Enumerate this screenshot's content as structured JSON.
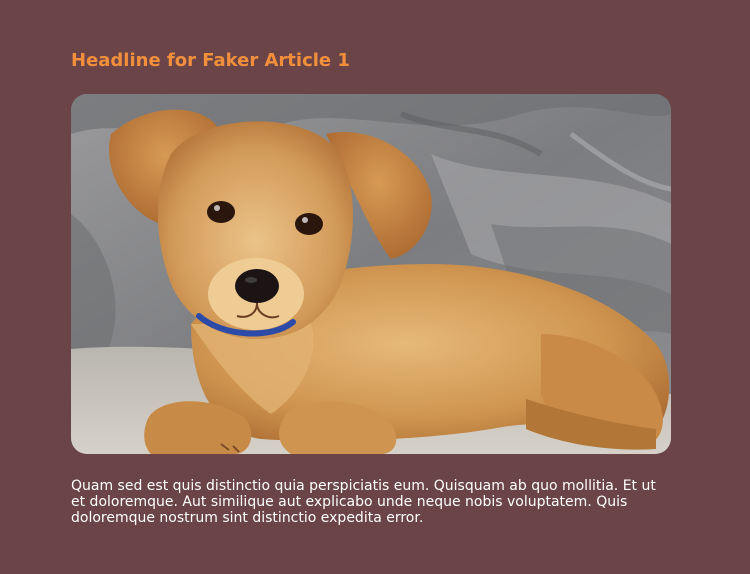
{
  "article": {
    "headline": "Headline for Faker Article 1",
    "image": {
      "subject": "puppy-photo"
    },
    "body": "Quam sed est quis distinctio quia perspiciatis eum. Quisquam ab quo mollitia. Et ut et doloremque. Aut similique aut explicabo unde neque nobis voluptatem. Quis doloremque nostrum sint distinctio expedita error."
  },
  "colors": {
    "background": "#6a4446",
    "headline": "#f28f3c",
    "body_text": "#ffffff"
  }
}
